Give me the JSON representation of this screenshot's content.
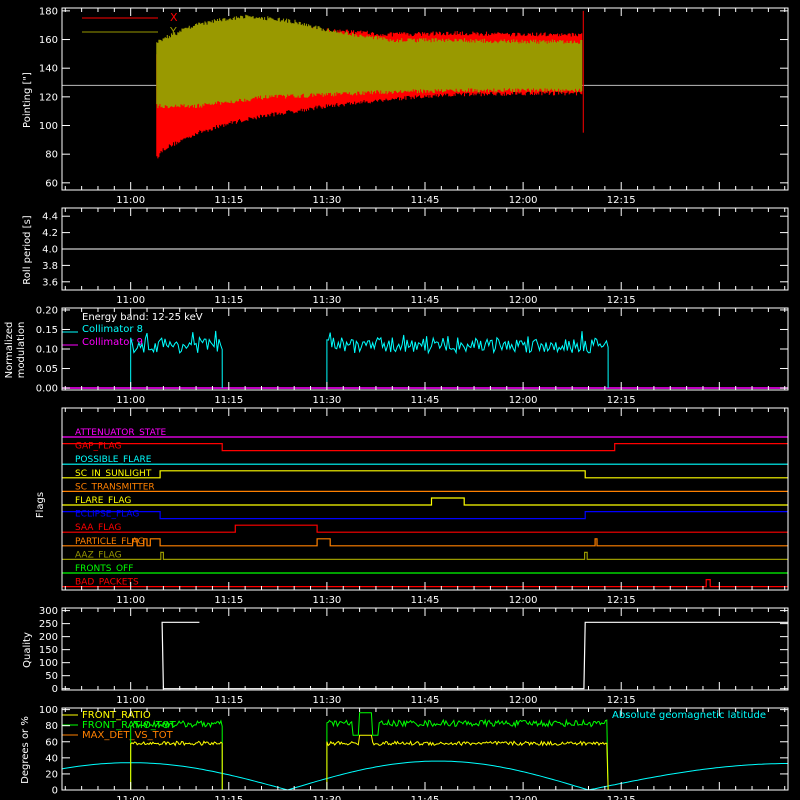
{
  "chart_data": [
    {
      "type": "line",
      "ylabel": "Pointing [\"]",
      "ylim": [
        55,
        182
      ],
      "yticks": [
        60,
        80,
        100,
        120,
        140,
        160,
        180
      ],
      "xticks": [
        "11:00",
        "11:15",
        "11:30",
        "11:45",
        "12:00",
        "12:15"
      ],
      "xlim_minutes": [
        10.5,
        100.5
      ],
      "reference_line": 128,
      "legend": [
        {
          "name": "X",
          "color": "#ff0000"
        },
        {
          "name": "Y",
          "color": "#999900"
        }
      ],
      "series": [
        {
          "name": "X",
          "color": "#ff0000",
          "t_start": "11:04",
          "t_end": "12:09",
          "upper_envelope": [
            [
              4,
              150
            ],
            [
              5,
              152
            ],
            [
              10,
              162
            ],
            [
              15,
              170
            ],
            [
              20,
              172
            ],
            [
              30,
              168
            ],
            [
              40,
              165
            ],
            [
              50,
              166
            ],
            [
              60,
              165
            ],
            [
              69,
              165
            ]
          ],
          "lower_envelope": [
            [
              4,
              76
            ],
            [
              5,
              82
            ],
            [
              10,
              93
            ],
            [
              15,
              100
            ],
            [
              20,
              105
            ],
            [
              30,
              112
            ],
            [
              40,
              117
            ],
            [
              50,
              120
            ],
            [
              60,
              121
            ],
            [
              69,
              121
            ]
          ]
        },
        {
          "name": "Y",
          "color": "#999900",
          "t_start": "11:04",
          "t_end": "12:09",
          "upper_envelope": [
            [
              4,
              160
            ],
            [
              10,
              172
            ],
            [
              15,
              176
            ],
            [
              18,
              178
            ],
            [
              25,
              174
            ],
            [
              30,
              168
            ],
            [
              40,
              161
            ],
            [
              50,
              161
            ],
            [
              60,
              160
            ],
            [
              69,
              160
            ]
          ],
          "lower_envelope": [
            [
              4,
              112
            ],
            [
              10,
              112
            ],
            [
              15,
              115
            ],
            [
              20,
              118
            ],
            [
              30,
              120
            ],
            [
              40,
              122
            ],
            [
              50,
              123
            ],
            [
              60,
              123
            ],
            [
              69,
              123
            ]
          ]
        }
      ]
    },
    {
      "type": "line",
      "ylabel": "Roll period [s]",
      "ylim": [
        3.5,
        4.5
      ],
      "yticks": [
        3.6,
        3.8,
        4.0,
        4.2,
        4.4
      ],
      "xticks": [
        "11:00",
        "11:15",
        "11:30",
        "11:45",
        "12:00",
        "12:15"
      ],
      "series": [
        {
          "name": "Roll period",
          "color": "#ffffff",
          "values": [
            [
              10.5,
              4.0
            ],
            [
              100.5,
              4.0
            ]
          ]
        }
      ]
    },
    {
      "type": "line",
      "ylabel": "Normalized modulation",
      "ylim": [
        -0.005,
        0.205
      ],
      "yticks": [
        0.0,
        0.05,
        0.1,
        0.15,
        0.2
      ],
      "ytick_labels": [
        "0.00",
        "0.05",
        "0.10",
        "0.15",
        "0.20"
      ],
      "xticks": [
        "11:00",
        "11:15",
        "11:30",
        "11:45",
        "12:00",
        "12:15"
      ],
      "annotation": "Energy band: 12-25 keV",
      "series": [
        {
          "name": "Collimator 8",
          "color": "#00ffff",
          "segments": [
            [
              0,
              14,
              0.11
            ],
            [
              30,
              73,
              0.11
            ]
          ]
        },
        {
          "name": "Collimator 9",
          "color": "#ff00ff",
          "constant": 0.0
        }
      ]
    },
    {
      "type": "line",
      "ylabel": "Flags",
      "xticks": [
        "11:00",
        "11:15",
        "11:30",
        "11:45",
        "12:00",
        "12:15"
      ],
      "flags": [
        {
          "name": "ATTENUATOR_STATE",
          "color": "#ff00ff",
          "states": []
        },
        {
          "name": "GAP_FLAG",
          "color": "#ff0000",
          "states": [
            [
              10.5,
              1
            ],
            [
              14,
              0
            ],
            [
              74,
              1
            ]
          ]
        },
        {
          "name": "POSSIBLE_FLARE",
          "color": "#00ffff",
          "states": []
        },
        {
          "name": "SC_IN_SUNLIGHT",
          "color": "#ffff00",
          "states": [
            [
              10.5,
              0
            ],
            [
              4.5,
              1
            ],
            [
              69.5,
              0
            ]
          ]
        },
        {
          "name": "SC_TRANSMITTER",
          "color": "#ff8000",
          "states": []
        },
        {
          "name": "FLARE_FLAG",
          "color": "#ffff00",
          "states": [
            [
              10.5,
              0
            ],
            [
              46,
              1
            ],
            [
              51,
              0
            ]
          ]
        },
        {
          "name": "ECLIPSE_FLAG",
          "color": "#0000ff",
          "states": [
            [
              10.5,
              1
            ],
            [
              4.5,
              0
            ],
            [
              69.5,
              1
            ]
          ]
        },
        {
          "name": "SAA_FLAG",
          "color": "#ff0000",
          "states": [
            [
              10.5,
              0
            ],
            [
              16,
              1
            ],
            [
              28.5,
              0
            ]
          ]
        },
        {
          "name": "PARTICLE_FLAG",
          "color": "#ff8000",
          "states": [
            [
              10.5,
              0
            ],
            [
              0.3,
              1
            ],
            [
              1,
              0
            ],
            [
              2,
              1
            ],
            [
              2.5,
              0
            ],
            [
              3,
              1
            ],
            [
              4.5,
              0
            ],
            [
              28.5,
              1
            ],
            [
              30.5,
              0
            ],
            [
              71,
              1
            ],
            [
              71.3,
              0
            ]
          ]
        },
        {
          "name": "AAZ_FLAG",
          "color": "#999900",
          "states": [
            [
              10.5,
              0
            ],
            [
              4.6,
              1
            ],
            [
              5,
              0
            ],
            [
              69.4,
              1
            ],
            [
              69.8,
              0
            ]
          ]
        },
        {
          "name": "FRONTS_OFF",
          "color": "#00ff00",
          "states": []
        },
        {
          "name": "BAD_PACKETS",
          "color": "#ff0000",
          "states": [
            [
              10.5,
              0
            ],
            [
              88,
              1
            ],
            [
              88.6,
              0
            ]
          ]
        }
      ]
    },
    {
      "type": "line",
      "ylabel": "Quality",
      "ylim": [
        -5,
        310
      ],
      "yticks": [
        0,
        50,
        100,
        150,
        200,
        250,
        300
      ],
      "xticks": [
        "11:00",
        "11:15",
        "11:30",
        "11:45",
        "12:00",
        "12:15"
      ],
      "series": [
        {
          "name": "Quality",
          "color": "#ffffff",
          "values": [
            [
              10.5,
              255
            ],
            [
              4.8,
              255
            ],
            [
              5,
              0
            ],
            [
              69.3,
              0
            ],
            [
              69.5,
              255
            ],
            [
              100.5,
              255
            ]
          ]
        }
      ]
    },
    {
      "type": "line",
      "ylabel": "Degrees or %",
      "ylim": [
        0,
        102
      ],
      "yticks": [
        0,
        20,
        40,
        60,
        80,
        100
      ],
      "xticks": [
        "11:00",
        "11:15",
        "11:30",
        "11:45",
        "12:00",
        "12:15"
      ],
      "legend": [
        {
          "name": "FRONT_RATIO",
          "color": "#ffff00"
        },
        {
          "name": "FRONT_RATIO_TOT",
          "color": "#00ff00"
        },
        {
          "name": "MAX_DET_VS_TOT",
          "color": "#ff8000"
        }
      ],
      "annotation": "Absolute geomagnetic latitude",
      "series": [
        {
          "name": "FRONT_RATIO",
          "color": "#ffff00",
          "segments": [
            [
              0,
              14,
              58
            ],
            [
              30,
              73,
              58
            ]
          ]
        },
        {
          "name": "FRONT_RATIO_TOT",
          "color": "#00ff00",
          "segments": [
            [
              0,
              14,
              82
            ],
            [
              30,
              73,
              83
            ]
          ]
        },
        {
          "name": "Absolute geomagnetic latitude",
          "color": "#00ffff",
          "values": [
            [
              10.5,
              17
            ],
            [
              0,
              34
            ],
            [
              24,
              0
            ],
            [
              47,
              36
            ],
            [
              70,
              0
            ],
            [
              100.5,
              33
            ]
          ]
        }
      ]
    }
  ]
}
